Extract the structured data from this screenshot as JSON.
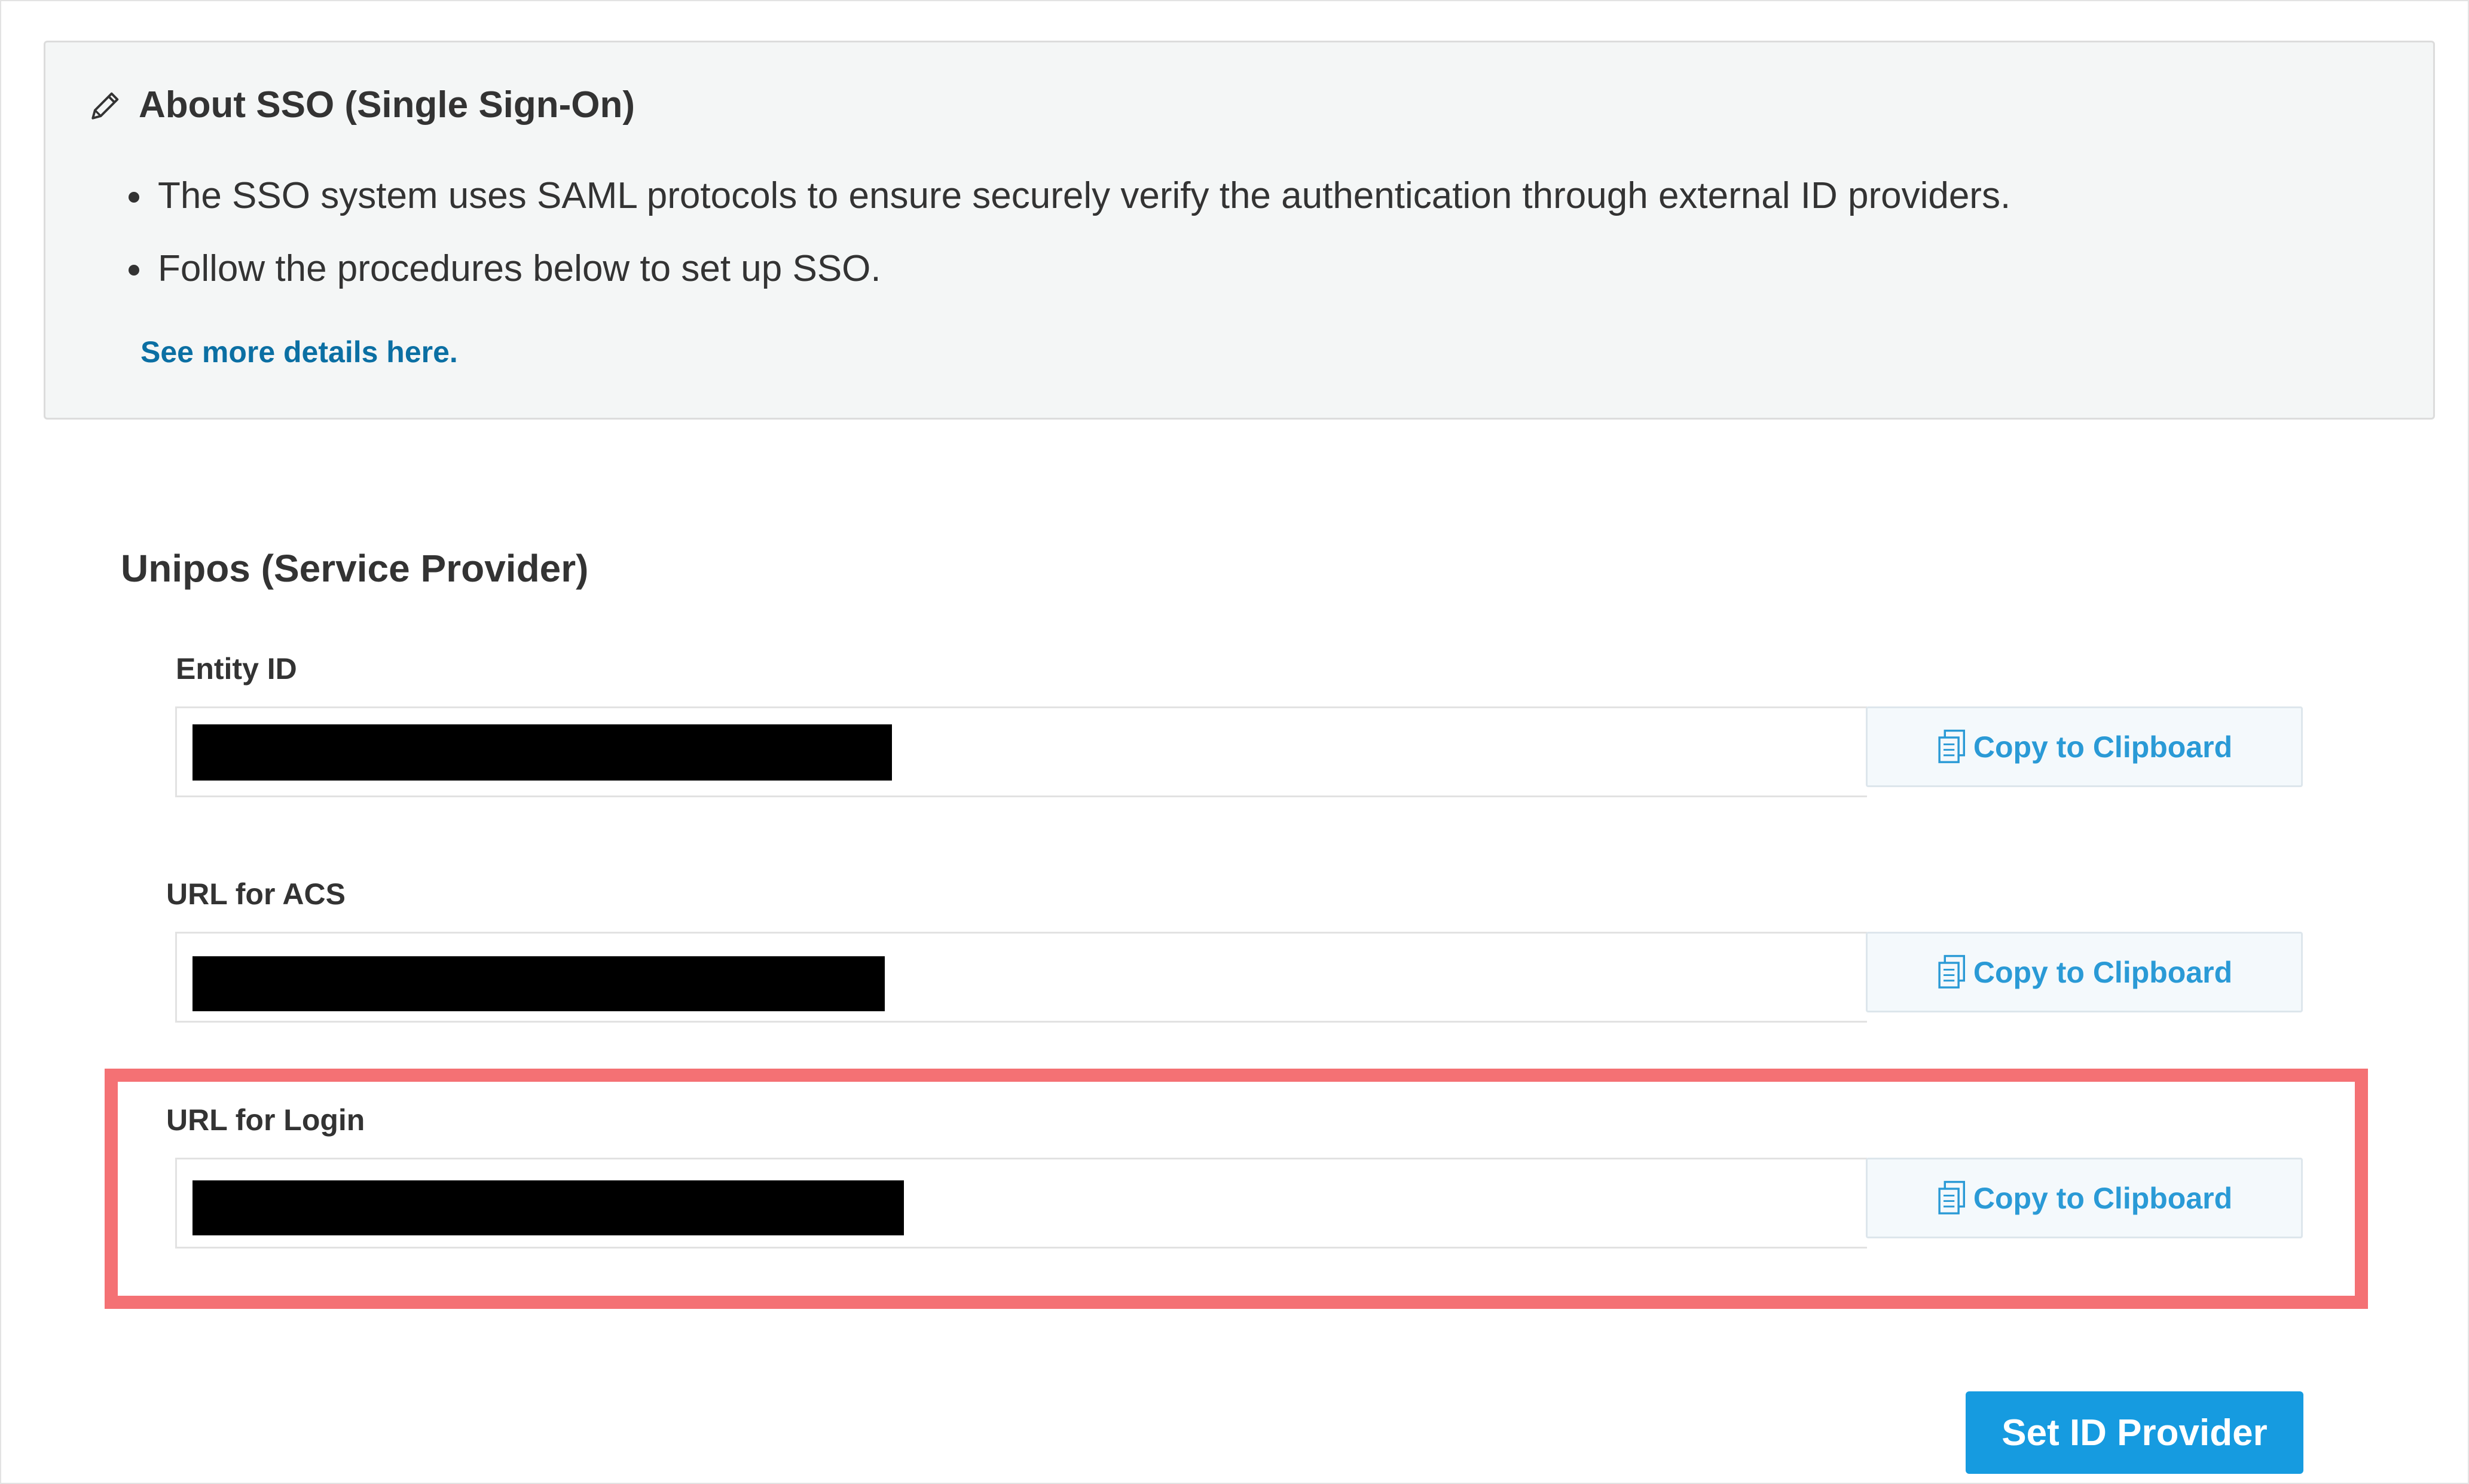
{
  "info": {
    "icon": "pencil-icon",
    "title": "About SSO (Single Sign-On)",
    "bullets": [
      "The SSO system uses SAML protocols to ensure securely verify the authentication through external ID providers.",
      "Follow the procedures below to set up SSO."
    ],
    "link": "See more details here."
  },
  "section": {
    "title": "Unipos (Service Provider)"
  },
  "fields": [
    {
      "label": "Entity ID",
      "copy_label": "Copy to Clipboard",
      "copy_icon": "clipboard-icon"
    },
    {
      "label": "URL for ACS",
      "copy_label": "Copy to Clipboard",
      "copy_icon": "clipboard-icon"
    },
    {
      "label": "URL for Login",
      "copy_label": "Copy to Clipboard",
      "copy_icon": "clipboard-icon"
    }
  ],
  "actions": {
    "set_provider": "Set ID Provider"
  },
  "colors": {
    "link": "#0b6fa3",
    "copy_text": "#2a9ad6",
    "primary_button": "#169be0",
    "highlight": "#f47174",
    "redaction": "#000000"
  }
}
